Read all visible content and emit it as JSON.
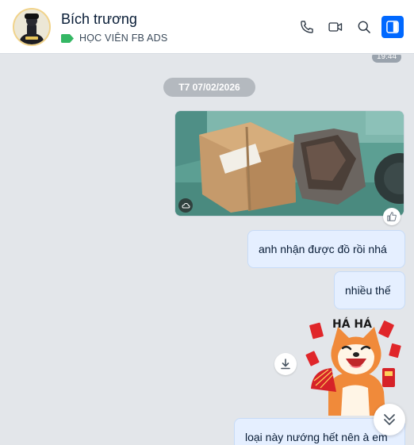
{
  "header": {
    "contact_name": "Bích trương",
    "tag_label": "HỌC VIÊN FB ADS",
    "tag_color": "#34b764",
    "actions": [
      "phone-icon",
      "video-icon",
      "search-icon",
      "sidebar-toggle-icon"
    ],
    "accent": "#0068ff"
  },
  "chat": {
    "time_label": "19:44",
    "date_divider": "T7 07/02/2026",
    "sticker_text": "HÁ HÁ",
    "messages": [
      {
        "text": "anh nhận được đồ rồi nhá"
      },
      {
        "text": "nhiều thế"
      },
      {
        "text": "loại này nướng hết nên à em"
      }
    ]
  },
  "colors": {
    "bubble_bg": "#e5efff",
    "chat_bg": "#e3e6ea"
  }
}
